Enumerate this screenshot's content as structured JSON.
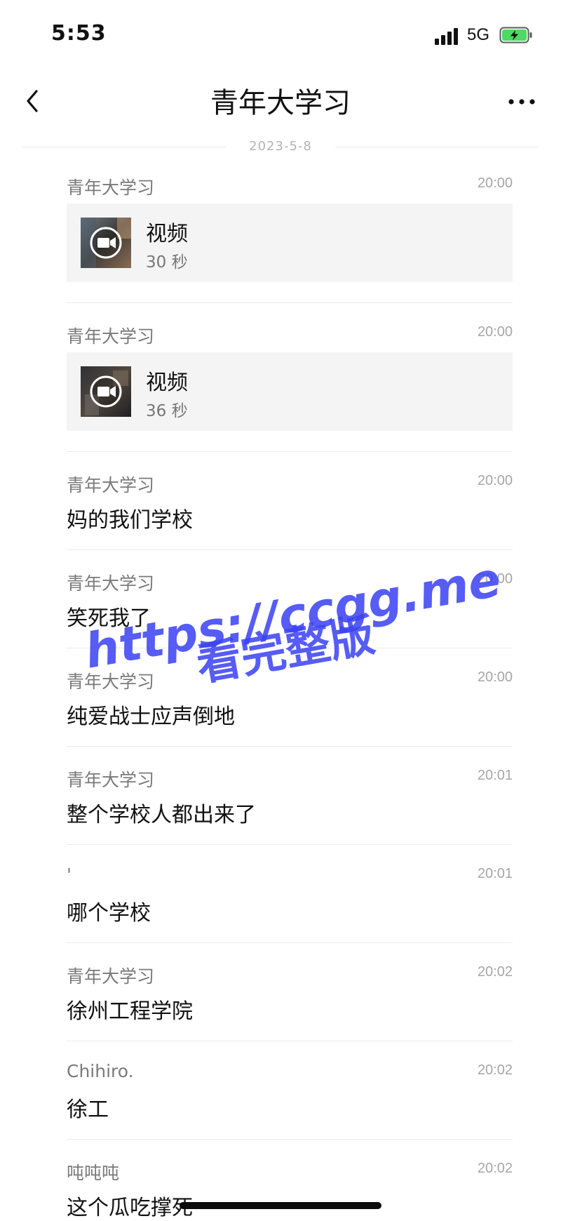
{
  "status_bar": {
    "time": "5:53",
    "network": "5G"
  },
  "header": {
    "title": "青年大学习"
  },
  "date_divider": "2023-5-8",
  "messages": [
    {
      "sender": "青年大学习",
      "time": "20:00",
      "video": {
        "title": "视频",
        "duration": "30 秒"
      }
    },
    {
      "sender": "青年大学习",
      "time": "20:00",
      "video": {
        "title": "视频",
        "duration": "36 秒"
      }
    },
    {
      "sender": "青年大学习",
      "time": "20:00",
      "text": "妈的我们学校"
    },
    {
      "sender": "青年大学习",
      "time": "20:00",
      "text": "笑死我了"
    },
    {
      "sender": "青年大学习",
      "time": "20:00",
      "text": "纯爱战士应声倒地"
    },
    {
      "sender": "青年大学习",
      "time": "20:01",
      "text": "整个学校人都出来了"
    },
    {
      "sender": "'",
      "time": "20:01",
      "text": "哪个学校"
    },
    {
      "sender": "青年大学习",
      "time": "20:02",
      "text": "徐州工程学院"
    },
    {
      "sender": "Chihiro.",
      "time": "20:02",
      "text": "徐工"
    },
    {
      "sender": "吨吨吨",
      "time": "20:02",
      "text": "这个瓜吃撑死"
    }
  ],
  "watermark": {
    "line1": "https://ccgg.me",
    "line2": "看完整版",
    "color": "#3a41f2"
  },
  "colors": {
    "background": "#ffffff",
    "video_card": "#f4f4f4",
    "battery_fill": "#4cd964"
  },
  "icons": [
    "back-chevron-icon",
    "more-dots-icon",
    "signal-icon",
    "battery-charging-icon",
    "video-camera-icon"
  ]
}
